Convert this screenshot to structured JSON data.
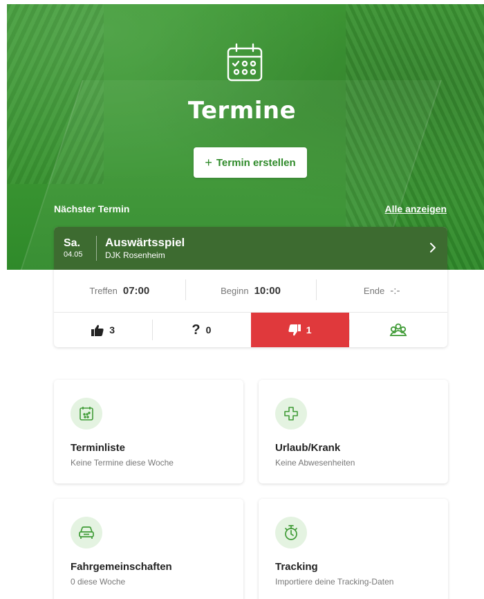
{
  "hero": {
    "title": "Termine",
    "create_button_label": "Termin erstellen",
    "next_label": "Nächster Termin",
    "all_link": "Alle anzeigen"
  },
  "event": {
    "day": "Sa.",
    "date": "04.05",
    "title": "Auswärtsspiel",
    "subtitle": "DJK Rosenheim",
    "meet_label": "Treffen",
    "meet_time": "07:00",
    "start_label": "Beginn",
    "start_time": "10:00",
    "end_label": "Ende",
    "end_time": "-:-",
    "yes_count": "3",
    "maybe_count": "0",
    "no_count": "1"
  },
  "tiles": [
    {
      "title": "Terminliste",
      "subtitle": "Keine Termine diese Woche",
      "icon": "calendar-icon"
    },
    {
      "title": "Urlaub/Krank",
      "subtitle": "Keine Abwesenheiten",
      "icon": "medical-cross-icon"
    },
    {
      "title": "Fahrgemeinschaften",
      "subtitle": "0 diese Woche",
      "icon": "car-icon"
    },
    {
      "title": "Tracking",
      "subtitle": "Importiere deine Tracking-Daten",
      "icon": "stopwatch-icon"
    }
  ],
  "colors": {
    "brand_green": "#3f9b36",
    "event_header": "#3d6b30",
    "decline_red": "#e0393c",
    "icon_bg": "#e4f3e1"
  }
}
